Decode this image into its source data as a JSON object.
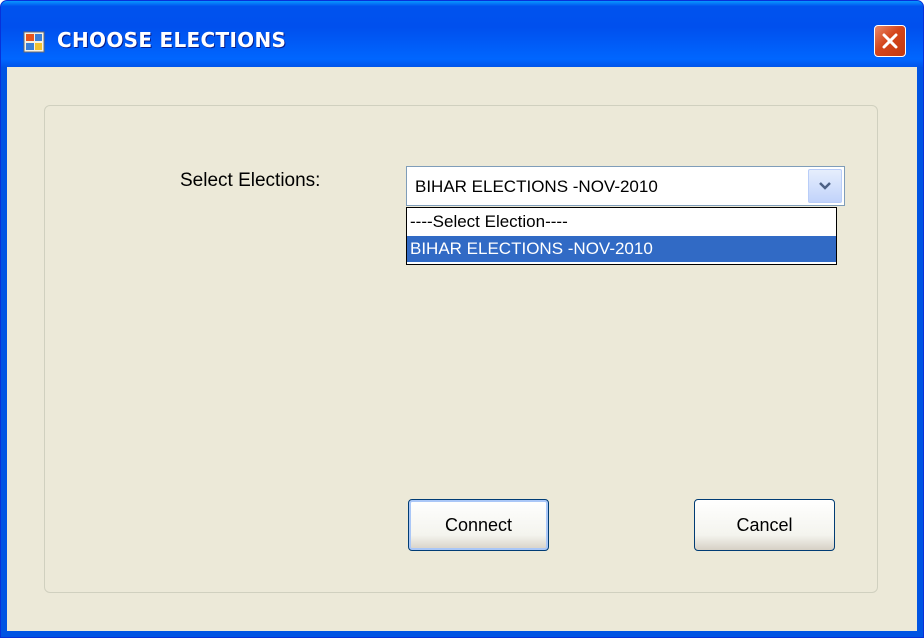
{
  "window": {
    "title": "CHOOSE ELECTIONS",
    "icon": "app-window-icon",
    "close_icon": "close-icon"
  },
  "form": {
    "select_label": "Select Elections:",
    "combo": {
      "selected_value": "BIHAR ELECTIONS -NOV-2010",
      "arrow_icon": "chevron-down-icon"
    },
    "dropdown": {
      "options": [
        "----Select Election----",
        "BIHAR ELECTIONS -NOV-2010"
      ],
      "highlighted_index": 1
    }
  },
  "buttons": {
    "connect_label": "Connect",
    "cancel_label": "Cancel"
  },
  "colors": {
    "titlebar": "#0054e3",
    "client_bg": "#ece9d8",
    "highlight": "#316ac5",
    "close_button": "#d4451b"
  }
}
